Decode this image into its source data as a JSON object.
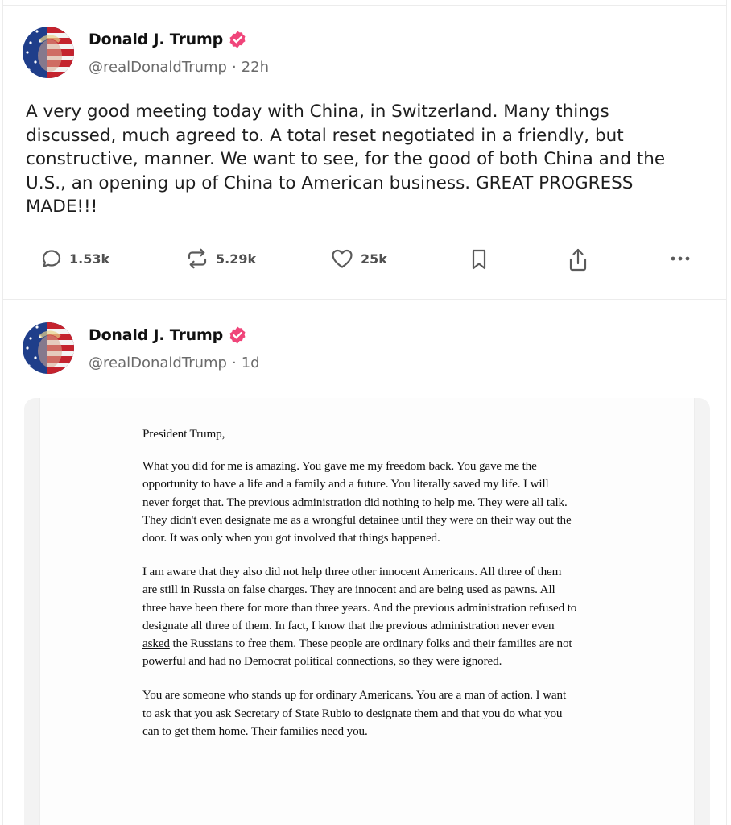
{
  "posts": [
    {
      "author": {
        "display_name": "Donald J. Trump",
        "handle": "@realDonaldTrump",
        "verified_icon": "verified-badge-icon",
        "avatar": "avatar"
      },
      "separator": "·",
      "time": "22h",
      "text": "A very good meeting today with China, in Switzerland. Many things discussed, much agreed to. A total reset negotiated in a friendly, but constructive, manner. We want to see, for the good of both China and the U.S., an opening up of China to American business. GREAT PROGRESS MADE!!!",
      "actions": {
        "replies": "1.53k",
        "reposts": "5.29k",
        "likes": "25k"
      }
    },
    {
      "author": {
        "display_name": "Donald J. Trump",
        "handle": "@realDonaldTrump",
        "verified_icon": "verified-badge-icon",
        "avatar": "avatar"
      },
      "separator": "·",
      "time": "1d",
      "media": {
        "type": "scanned-letter",
        "salutation": "President Trump,",
        "paragraph_1": "What you did for me is amazing. You gave me my freedom back. You gave me the opportunity to have a life and a family and a future. You literally saved my life. I will never forget that. The previous administration did nothing to help me. They were all talk. They didn't even designate me as a wrongful detainee until they were on their way out the door. It was only when you got involved that things happened.",
        "paragraph_2_before": "I am aware that they also did not help three other innocent Americans. All three of them are still in Russia on false charges. They are innocent and are being used as pawns. All three have been there for more than three years. And the previous administration refused to designate all three of them. In fact, I know that the previous administration never even ",
        "paragraph_2_underlined": "asked",
        "paragraph_2_after": " the Russians to free them. These people are ordinary folks and their families are not powerful and had no Democrat political connections, so they were ignored.",
        "paragraph_3": "You are someone who stands up for ordinary Americans. You are a man of action. I want to ask that you ask Secretary of State Rubio to designate them and that you do what you can to get them home. Their families need you."
      }
    }
  ],
  "colors": {
    "verified_badge": "#f0457a",
    "action_icon": "#5a5a5a",
    "handle_text": "#6b6b6b",
    "divider": "#ececec"
  }
}
